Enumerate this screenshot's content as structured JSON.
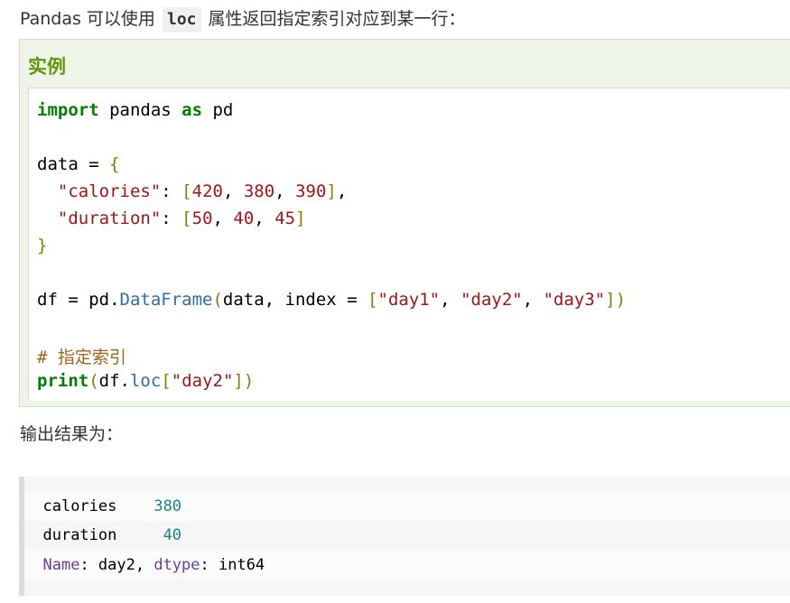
{
  "intro": {
    "prefix": "Pandas 可以使用 ",
    "code": "loc",
    "suffix": " 属性返回指定索引对应到某一行："
  },
  "example": {
    "title": "实例",
    "code": {
      "l1_import": "import",
      "l1_mod": " pandas ",
      "l1_as": "as",
      "l1_alias": " pd",
      "l3_a": "data = ",
      "l3_b": "{",
      "l4_indent": "  ",
      "l4_key": "\"calories\"",
      "l4_colon": ": ",
      "l4_open": "[",
      "l4_v1": "420",
      "l4_c1": ", ",
      "l4_v2": "380",
      "l4_c2": ", ",
      "l4_v3": "390",
      "l4_close": "]",
      "l4_end": ",",
      "l5_indent": "  ",
      "l5_key": "\"duration\"",
      "l5_colon": ": ",
      "l5_open": "[",
      "l5_v1": "50",
      "l5_c1": ", ",
      "l5_v2": "40",
      "l5_c2": ", ",
      "l5_v3": "45",
      "l5_close": "]",
      "l6_close": "}",
      "l8_a": "df = pd.",
      "l8_fn": "DataFrame",
      "l8_p1": "(",
      "l8_b": "data, index = ",
      "l8_o": "[",
      "l8_s1": "\"day1\"",
      "l8_c1": ", ",
      "l8_s2": "\"day2\"",
      "l8_c2": ", ",
      "l8_s3": "\"day3\"",
      "l8_cb": "]",
      "l8_cp": ")",
      "l10_comment": "# 指定索引",
      "l11_print": "print",
      "l11_p1": "(",
      "l11_a": "df.",
      "l11_loc": "loc",
      "l11_o": "[",
      "l11_s": "\"day2\"",
      "l11_cb": "]",
      "l11_cp": ")"
    }
  },
  "output": {
    "label": "输出结果为：",
    "rows": [
      {
        "key": "calories",
        "pad": "    ",
        "value": "380"
      },
      {
        "key": "duration",
        "pad": "     ",
        "value": "40"
      }
    ],
    "meta": {
      "name_label": "Name",
      "name_sep": ": day2, ",
      "dtype_label": "dtype",
      "dtype_sep": ": int64"
    }
  }
}
